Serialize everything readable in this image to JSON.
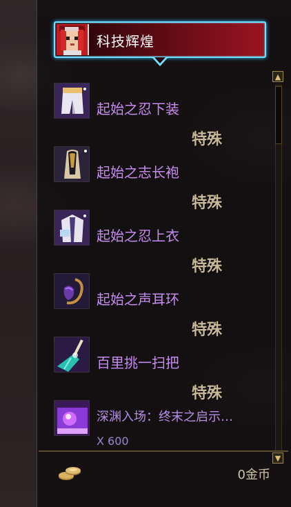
{
  "header": {
    "title": "科技辉煌",
    "avatar_icon": "pixel-character-face-icon",
    "border_color": "#6fe0ff"
  },
  "items": [
    {
      "name": "起始之忍下装",
      "tag": "特殊",
      "icon": "white-pants-icon"
    },
    {
      "name": "起始之志长袍",
      "tag": "特殊",
      "icon": "golden-robe-icon"
    },
    {
      "name": "起始之忍上衣",
      "tag": "特殊",
      "icon": "white-coat-icon"
    },
    {
      "name": "起始之声耳环",
      "tag": "特殊",
      "icon": "purple-earring-icon"
    },
    {
      "name": "百里挑一扫把",
      "tag": "特殊",
      "icon": "teal-broom-icon"
    }
  ],
  "last_item": {
    "name": "深渊入场：终末之启示…",
    "qty": "X 600",
    "icon": "purple-crystal-ticket-icon"
  },
  "scrollbar": {
    "up": "▲",
    "down": "▼"
  },
  "footer": {
    "gold": "0金币",
    "icon": "gold-coins-icon"
  },
  "colors": {
    "item_name": "#c68cf0",
    "tag": "#c8b898"
  }
}
